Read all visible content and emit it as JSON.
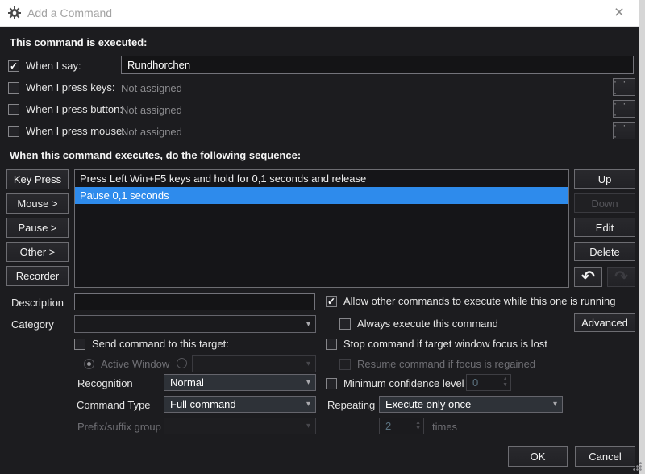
{
  "window": {
    "title": "Add a Command"
  },
  "icons": {
    "close": "×",
    "check": "✓",
    "dropdown_arrow": "▾",
    "ellipsis": "· · ·",
    "undo": "↶",
    "redo": "↷",
    "spin_up": "▲",
    "spin_down": "▼"
  },
  "colors": {
    "accent": "#2e8bec",
    "titlebar_bg": "#ffffff",
    "body_bg": "#1c1c1f"
  },
  "executed": {
    "header": "This command is executed:",
    "when_i_say": {
      "label": "When I say:",
      "checked": true,
      "value": "Rundhorchen"
    },
    "rows": [
      {
        "label": "When I press keys:",
        "checked": false,
        "value": "Not assigned"
      },
      {
        "label": "When I press button:",
        "checked": false,
        "value": "Not assigned"
      },
      {
        "label": "When I press mouse:",
        "checked": false,
        "value": "Not assigned"
      }
    ]
  },
  "sequence": {
    "header": "When this command executes, do the following sequence:",
    "left_buttons": [
      "Key Press",
      "Mouse >",
      "Pause >",
      "Other >",
      "Recorder"
    ],
    "items": [
      {
        "text": "Press Left Win+F5 keys and hold for 0,1 seconds and release",
        "selected": false
      },
      {
        "text": "Pause 0,1 seconds",
        "selected": true
      }
    ],
    "right_buttons": [
      {
        "label": "Up",
        "disabled": false
      },
      {
        "label": "Down",
        "disabled": true
      },
      {
        "label": "Edit",
        "disabled": false
      },
      {
        "label": "Delete",
        "disabled": false
      }
    ]
  },
  "details": {
    "description_label": "Description",
    "description_value": "",
    "category_label": "Category",
    "send_target_label": "Send command to this target:",
    "active_window_label": "Active Window",
    "recognition_label": "Recognition",
    "recognition_value": "Normal",
    "command_type_label": "Command Type",
    "command_type_value": "Full command",
    "prefix_suffix_label": "Prefix/suffix group"
  },
  "options": {
    "allow_other": "Allow other commands to execute while this one is running",
    "always_execute": "Always execute this command",
    "advanced_button": "Advanced",
    "stop_command": "Stop command if target window focus is lost",
    "resume_command": "Resume command if focus is regained",
    "min_confidence": "Minimum confidence level",
    "min_confidence_value": "0",
    "repeating_label": "Repeating",
    "repeating_value": "Execute only once",
    "repeat_count": "2",
    "times_label": "times"
  },
  "footer": {
    "ok": "OK",
    "cancel": "Cancel"
  }
}
